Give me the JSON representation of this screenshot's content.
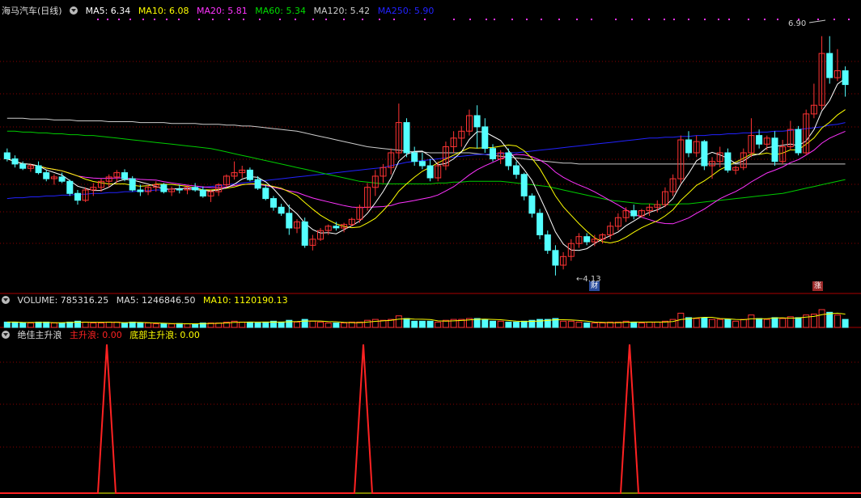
{
  "price_panel": {
    "title": "海马汽车(日线)",
    "legend": [
      {
        "label": "MA5: 6.34",
        "color": "#ffffff"
      },
      {
        "label": "MA10: 6.08",
        "color": "#ffff00"
      },
      {
        "label": "MA20: 5.81",
        "color": "#ff33ff"
      },
      {
        "label": "MA60: 5.34",
        "color": "#00dd00"
      },
      {
        "label": "MA120: 5.42",
        "color": "#cccccc"
      },
      {
        "label": "MA250: 5.90",
        "color": "#2222ff"
      }
    ],
    "high_label": "6.90",
    "low_label": "4.13",
    "event_tag_cai": "财",
    "event_tag_zhang": "涨"
  },
  "volume_panel": {
    "legend": [
      {
        "label": "VOLUME: 785316.25",
        "color": "#dddddd"
      },
      {
        "label": "MA5: 1246846.50",
        "color": "#dddddd"
      },
      {
        "label": "MA10: 1120190.13",
        "color": "#ffff00"
      }
    ]
  },
  "indicator_panel": {
    "name": "绝佳主升浪",
    "legend": [
      {
        "label": "主升浪: 0.00",
        "color": "#ff2222"
      },
      {
        "label": "底部主升浪: 0.00",
        "color": "#ffff00"
      }
    ]
  },
  "colors": {
    "up": "#ff3333",
    "down": "#54ffff",
    "grid": "#8b0000",
    "divider": "#aa0000"
  },
  "chart_data": {
    "type": "candlestick",
    "ohlc": [
      [
        5.55,
        5.6,
        5.45,
        5.48
      ],
      [
        5.48,
        5.52,
        5.38,
        5.42
      ],
      [
        5.42,
        5.45,
        5.35,
        5.37
      ],
      [
        5.37,
        5.42,
        5.33,
        5.4
      ],
      [
        5.4,
        5.45,
        5.3,
        5.32
      ],
      [
        5.32,
        5.35,
        5.22,
        5.25
      ],
      [
        5.25,
        5.3,
        5.18,
        5.27
      ],
      [
        5.27,
        5.32,
        5.2,
        5.22
      ],
      [
        5.22,
        5.24,
        5.05,
        5.08
      ],
      [
        5.08,
        5.12,
        4.95,
        5.0
      ],
      [
        5.0,
        5.15,
        4.98,
        5.12
      ],
      [
        5.12,
        5.2,
        5.05,
        5.15
      ],
      [
        5.15,
        5.25,
        5.1,
        5.22
      ],
      [
        5.22,
        5.3,
        5.15,
        5.27
      ],
      [
        5.27,
        5.35,
        5.2,
        5.32
      ],
      [
        5.32,
        5.36,
        5.22,
        5.25
      ],
      [
        5.25,
        5.28,
        5.1,
        5.12
      ],
      [
        5.12,
        5.18,
        5.05,
        5.1
      ],
      [
        5.1,
        5.18,
        5.06,
        5.15
      ],
      [
        5.15,
        5.22,
        5.1,
        5.18
      ],
      [
        5.18,
        5.2,
        5.08,
        5.1
      ],
      [
        5.1,
        5.16,
        5.05,
        5.13
      ],
      [
        5.13,
        5.18,
        5.08,
        5.12
      ],
      [
        5.12,
        5.17,
        5.07,
        5.15
      ],
      [
        5.15,
        5.2,
        5.1,
        5.12
      ],
      [
        5.12,
        5.16,
        5.03,
        5.05
      ],
      [
        5.05,
        5.12,
        4.98,
        5.1
      ],
      [
        5.1,
        5.2,
        5.05,
        5.18
      ],
      [
        5.18,
        5.3,
        5.15,
        5.28
      ],
      [
        5.28,
        5.45,
        5.24,
        5.32
      ],
      [
        5.32,
        5.4,
        5.26,
        5.35
      ],
      [
        5.35,
        5.38,
        5.22,
        5.24
      ],
      [
        5.24,
        5.28,
        5.12,
        5.14
      ],
      [
        5.14,
        5.18,
        5.0,
        5.02
      ],
      [
        5.02,
        5.05,
        4.88,
        4.92
      ],
      [
        4.92,
        4.96,
        4.82,
        4.85
      ],
      [
        4.85,
        4.95,
        4.6,
        4.68
      ],
      [
        4.68,
        4.78,
        4.62,
        4.75
      ],
      [
        4.75,
        4.8,
        4.45,
        4.48
      ],
      [
        4.48,
        4.6,
        4.42,
        4.55
      ],
      [
        4.55,
        4.68,
        4.53,
        4.65
      ],
      [
        4.65,
        4.72,
        4.6,
        4.7
      ],
      [
        4.7,
        4.75,
        4.65,
        4.68
      ],
      [
        4.68,
        4.74,
        4.63,
        4.72
      ],
      [
        4.72,
        4.8,
        4.7,
        4.78
      ],
      [
        4.78,
        4.95,
        4.74,
        4.92
      ],
      [
        4.92,
        5.2,
        4.88,
        5.15
      ],
      [
        5.15,
        5.35,
        5.05,
        5.28
      ],
      [
        5.28,
        5.42,
        5.2,
        5.38
      ],
      [
        5.38,
        5.6,
        5.3,
        5.55
      ],
      [
        5.55,
        6.12,
        5.48,
        5.9
      ],
      [
        5.9,
        5.95,
        5.5,
        5.55
      ],
      [
        5.55,
        5.62,
        5.4,
        5.45
      ],
      [
        5.45,
        5.55,
        5.36,
        5.4
      ],
      [
        5.4,
        5.48,
        5.22,
        5.26
      ],
      [
        5.26,
        5.45,
        5.22,
        5.4
      ],
      [
        5.4,
        5.68,
        5.35,
        5.62
      ],
      [
        5.62,
        5.8,
        5.55,
        5.72
      ],
      [
        5.72,
        5.86,
        5.62,
        5.8
      ],
      [
        5.8,
        6.05,
        5.75,
        5.98
      ],
      [
        5.98,
        6.1,
        5.6,
        5.85
      ],
      [
        5.85,
        5.95,
        5.55,
        5.6
      ],
      [
        5.6,
        5.65,
        5.45,
        5.48
      ],
      [
        5.48,
        5.58,
        5.42,
        5.55
      ],
      [
        5.55,
        5.6,
        5.35,
        5.4
      ],
      [
        5.4,
        5.45,
        5.25,
        5.3
      ],
      [
        5.3,
        5.32,
        5.0,
        5.05
      ],
      [
        5.05,
        5.08,
        4.8,
        4.85
      ],
      [
        4.85,
        4.9,
        4.55,
        4.6
      ],
      [
        4.6,
        4.65,
        4.38,
        4.42
      ],
      [
        4.42,
        4.48,
        4.13,
        4.25
      ],
      [
        4.25,
        4.4,
        4.2,
        4.35
      ],
      [
        4.35,
        4.55,
        4.3,
        4.5
      ],
      [
        4.5,
        4.62,
        4.45,
        4.58
      ],
      [
        4.58,
        4.62,
        4.48,
        4.52
      ],
      [
        4.52,
        4.6,
        4.47,
        4.55
      ],
      [
        4.55,
        4.62,
        4.5,
        4.6
      ],
      [
        4.6,
        4.75,
        4.55,
        4.7
      ],
      [
        4.7,
        4.85,
        4.65,
        4.8
      ],
      [
        4.8,
        4.92,
        4.75,
        4.88
      ],
      [
        4.88,
        4.95,
        4.78,
        4.82
      ],
      [
        4.82,
        4.9,
        4.8,
        4.88
      ],
      [
        4.88,
        4.96,
        4.82,
        4.92
      ],
      [
        4.92,
        5.0,
        4.86,
        4.95
      ],
      [
        4.95,
        5.15,
        4.92,
        5.1
      ],
      [
        5.1,
        5.3,
        5.05,
        5.25
      ],
      [
        5.25,
        5.75,
        5.2,
        5.7
      ],
      [
        5.7,
        5.8,
        5.5,
        5.55
      ],
      [
        5.55,
        5.75,
        5.5,
        5.68
      ],
      [
        5.68,
        5.7,
        5.35,
        5.4
      ],
      [
        5.4,
        5.5,
        5.25,
        5.45
      ],
      [
        5.45,
        5.62,
        5.38,
        5.55
      ],
      [
        5.55,
        5.6,
        5.32,
        5.35
      ],
      [
        5.35,
        5.4,
        5.3,
        5.38
      ],
      [
        5.38,
        5.6,
        5.35,
        5.55
      ],
      [
        5.55,
        5.95,
        5.5,
        5.75
      ],
      [
        5.75,
        5.82,
        5.6,
        5.65
      ],
      [
        5.65,
        5.75,
        5.58,
        5.72
      ],
      [
        5.72,
        5.8,
        5.4,
        5.45
      ],
      [
        5.45,
        5.7,
        5.42,
        5.62
      ],
      [
        5.62,
        5.92,
        5.58,
        5.82
      ],
      [
        5.82,
        5.86,
        5.52,
        5.55
      ],
      [
        5.55,
        6.05,
        5.52,
        6.0
      ],
      [
        6.0,
        6.35,
        5.95,
        6.1
      ],
      [
        6.1,
        6.9,
        6.05,
        6.7
      ],
      [
        6.7,
        6.9,
        6.35,
        6.42
      ],
      [
        6.42,
        6.75,
        6.38,
        6.5
      ],
      [
        6.5,
        6.55,
        6.2,
        6.34
      ]
    ],
    "volume_ratio": [
      0.3,
      0.3,
      0.25,
      0.25,
      0.3,
      0.3,
      0.25,
      0.25,
      0.3,
      0.35,
      0.3,
      0.25,
      0.25,
      0.3,
      0.3,
      0.25,
      0.3,
      0.25,
      0.25,
      0.2,
      0.2,
      0.2,
      0.22,
      0.2,
      0.2,
      0.25,
      0.25,
      0.25,
      0.3,
      0.35,
      0.3,
      0.3,
      0.25,
      0.3,
      0.35,
      0.3,
      0.4,
      0.3,
      0.45,
      0.35,
      0.3,
      0.25,
      0.25,
      0.25,
      0.3,
      0.3,
      0.4,
      0.45,
      0.4,
      0.45,
      0.65,
      0.5,
      0.35,
      0.35,
      0.35,
      0.3,
      0.4,
      0.45,
      0.45,
      0.5,
      0.5,
      0.45,
      0.35,
      0.35,
      0.3,
      0.3,
      0.35,
      0.4,
      0.45,
      0.45,
      0.5,
      0.35,
      0.35,
      0.3,
      0.25,
      0.25,
      0.25,
      0.3,
      0.3,
      0.35,
      0.3,
      0.25,
      0.3,
      0.3,
      0.35,
      0.45,
      0.8,
      0.55,
      0.5,
      0.55,
      0.45,
      0.45,
      0.45,
      0.35,
      0.45,
      0.7,
      0.5,
      0.45,
      0.55,
      0.5,
      0.6,
      0.55,
      0.7,
      0.75,
      1.0,
      0.85,
      0.7,
      0.45
    ],
    "ma120": [
      5.95,
      5.95,
      5.95,
      5.94,
      5.94,
      5.94,
      5.93,
      5.93,
      5.93,
      5.92,
      5.92,
      5.92,
      5.92,
      5.91,
      5.91,
      5.91,
      5.91,
      5.9,
      5.9,
      5.9,
      5.9,
      5.89,
      5.89,
      5.89,
      5.89,
      5.88,
      5.88,
      5.88,
      5.87,
      5.87,
      5.86,
      5.86,
      5.85,
      5.84,
      5.83,
      5.82,
      5.81,
      5.8,
      5.78,
      5.76,
      5.74,
      5.72,
      5.7,
      5.68,
      5.66,
      5.64,
      5.62,
      5.61,
      5.6,
      5.59,
      5.58,
      5.57,
      5.56,
      5.56,
      5.55,
      5.55,
      5.55,
      5.55,
      5.55,
      5.55,
      5.54,
      5.53,
      5.52,
      5.51,
      5.5,
      5.49,
      5.48,
      5.47,
      5.46,
      5.45,
      5.44,
      5.43,
      5.43,
      5.42,
      5.42,
      5.42,
      5.42,
      5.42,
      5.42,
      5.42,
      5.42,
      5.42,
      5.42,
      5.42,
      5.42,
      5.42,
      5.42,
      5.42,
      5.42,
      5.42,
      5.42,
      5.42,
      5.42,
      5.42,
      5.42,
      5.42,
      5.42,
      5.42,
      5.42,
      5.42,
      5.42,
      5.42,
      5.42,
      5.42,
      5.42,
      5.42,
      5.42,
      5.42
    ],
    "ma250": [
      5.02,
      5.03,
      5.03,
      5.04,
      5.04,
      5.05,
      5.05,
      5.06,
      5.06,
      5.07,
      5.07,
      5.08,
      5.08,
      5.09,
      5.09,
      5.1,
      5.1,
      5.11,
      5.11,
      5.12,
      5.12,
      5.13,
      5.13,
      5.14,
      5.14,
      5.15,
      5.16,
      5.17,
      5.18,
      5.19,
      5.2,
      5.21,
      5.22,
      5.23,
      5.24,
      5.25,
      5.26,
      5.27,
      5.28,
      5.29,
      5.3,
      5.31,
      5.32,
      5.33,
      5.34,
      5.35,
      5.36,
      5.37,
      5.38,
      5.4,
      5.42,
      5.44,
      5.45,
      5.46,
      5.47,
      5.48,
      5.49,
      5.5,
      5.51,
      5.52,
      5.53,
      5.53,
      5.54,
      5.54,
      5.55,
      5.55,
      5.56,
      5.57,
      5.58,
      5.59,
      5.6,
      5.61,
      5.62,
      5.63,
      5.64,
      5.65,
      5.66,
      5.67,
      5.68,
      5.69,
      5.7,
      5.71,
      5.72,
      5.72,
      5.73,
      5.73,
      5.74,
      5.74,
      5.75,
      5.75,
      5.76,
      5.76,
      5.77,
      5.77,
      5.78,
      5.78,
      5.79,
      5.79,
      5.8,
      5.8,
      5.81,
      5.82,
      5.83,
      5.84,
      5.85,
      5.87,
      5.88,
      5.9
    ],
    "ma60": [
      5.8,
      5.8,
      5.79,
      5.79,
      5.78,
      5.78,
      5.77,
      5.77,
      5.76,
      5.76,
      5.75,
      5.75,
      5.74,
      5.73,
      5.72,
      5.71,
      5.7,
      5.69,
      5.68,
      5.67,
      5.66,
      5.65,
      5.64,
      5.63,
      5.62,
      5.61,
      5.6,
      5.58,
      5.56,
      5.54,
      5.52,
      5.5,
      5.48,
      5.46,
      5.44,
      5.42,
      5.4,
      5.38,
      5.36,
      5.34,
      5.32,
      5.3,
      5.28,
      5.26,
      5.24,
      5.22,
      5.21,
      5.2,
      5.19,
      5.19,
      5.19,
      5.19,
      5.19,
      5.19,
      5.19,
      5.2,
      5.2,
      5.21,
      5.21,
      5.22,
      5.22,
      5.22,
      5.22,
      5.22,
      5.21,
      5.2,
      5.19,
      5.18,
      5.17,
      5.16,
      5.14,
      5.12,
      5.1,
      5.08,
      5.06,
      5.04,
      5.02,
      5.0,
      4.99,
      4.98,
      4.97,
      4.96,
      4.96,
      4.95,
      4.95,
      4.95,
      4.96,
      4.96,
      4.97,
      4.98,
      4.99,
      5.0,
      5.01,
      5.02,
      5.03,
      5.04,
      5.05,
      5.06,
      5.07,
      5.08,
      5.1,
      5.12,
      5.14,
      5.16,
      5.18,
      5.2,
      5.22,
      5.24
    ]
  }
}
